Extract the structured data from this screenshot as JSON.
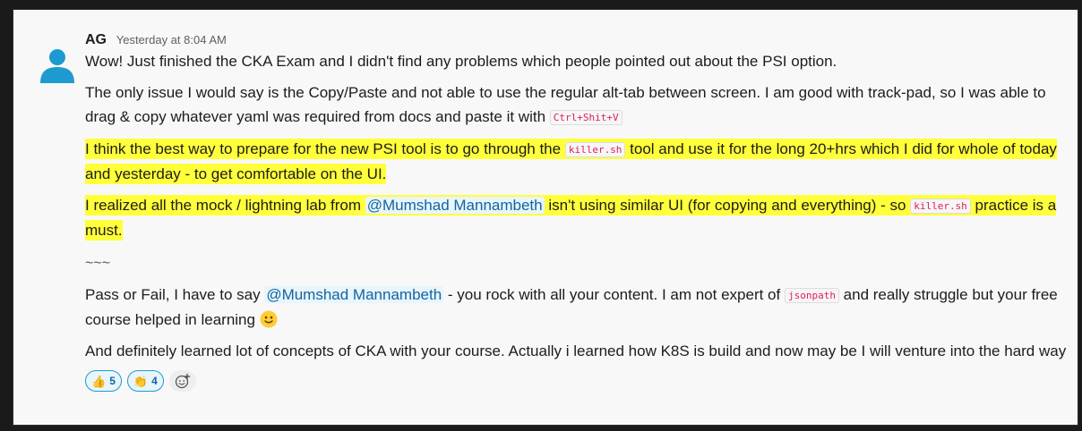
{
  "message": {
    "author": "AG",
    "timestamp": "Yesterday at 8:04 AM",
    "avatar_icon": "user-avatar-icon",
    "para1": "Wow! Just finished the CKA Exam and I didn't find any problems which people pointed out about the PSI option.",
    "para2": {
      "text": "The only issue I would say is the Copy/Paste and not able to use the regular alt-tab between screen. I am good with track-pad, so I was able to drag & copy whatever yaml was required from docs and paste it with ",
      "code": "Ctrl+Shit+V"
    },
    "para3": {
      "pre": "I think the best way to prepare for the new PSI tool is to go through the ",
      "code": "killer.sh",
      "post": " tool and use it for the long 20+hrs which I did for whole of today and yesterday - to get comfortable on the UI."
    },
    "para4": {
      "pre": "I realized all the mock / lightning lab from ",
      "mention": "@Mumshad Mannambeth",
      "mid": " isn't using similar UI (for copying and everything) - so ",
      "code": "killer.sh",
      "post": " practice is a must."
    },
    "separator": "~~~",
    "para5": {
      "pre": "Pass or Fail, I have to say ",
      "mention": "@Mumshad Mannambeth",
      "mid": " - you rock with all your content. I am not expert of ",
      "code": "jsonpath",
      "post": " and really struggle but your free course helped in learning ",
      "emoji": "slightly-smiling-face-icon"
    },
    "para6": "And definitely learned lot of concepts of CKA with your course. Actually i learned how K8S is build and now may be I will venture into the hard way",
    "highlight_color": "#ffff3a",
    "reactions": [
      {
        "emoji": "thumbs-up-icon",
        "glyph": "👍",
        "count": "5"
      },
      {
        "emoji": "clap-icon",
        "glyph": "👏",
        "count": "4"
      }
    ],
    "add_reaction_icon": "add-reaction-icon"
  }
}
